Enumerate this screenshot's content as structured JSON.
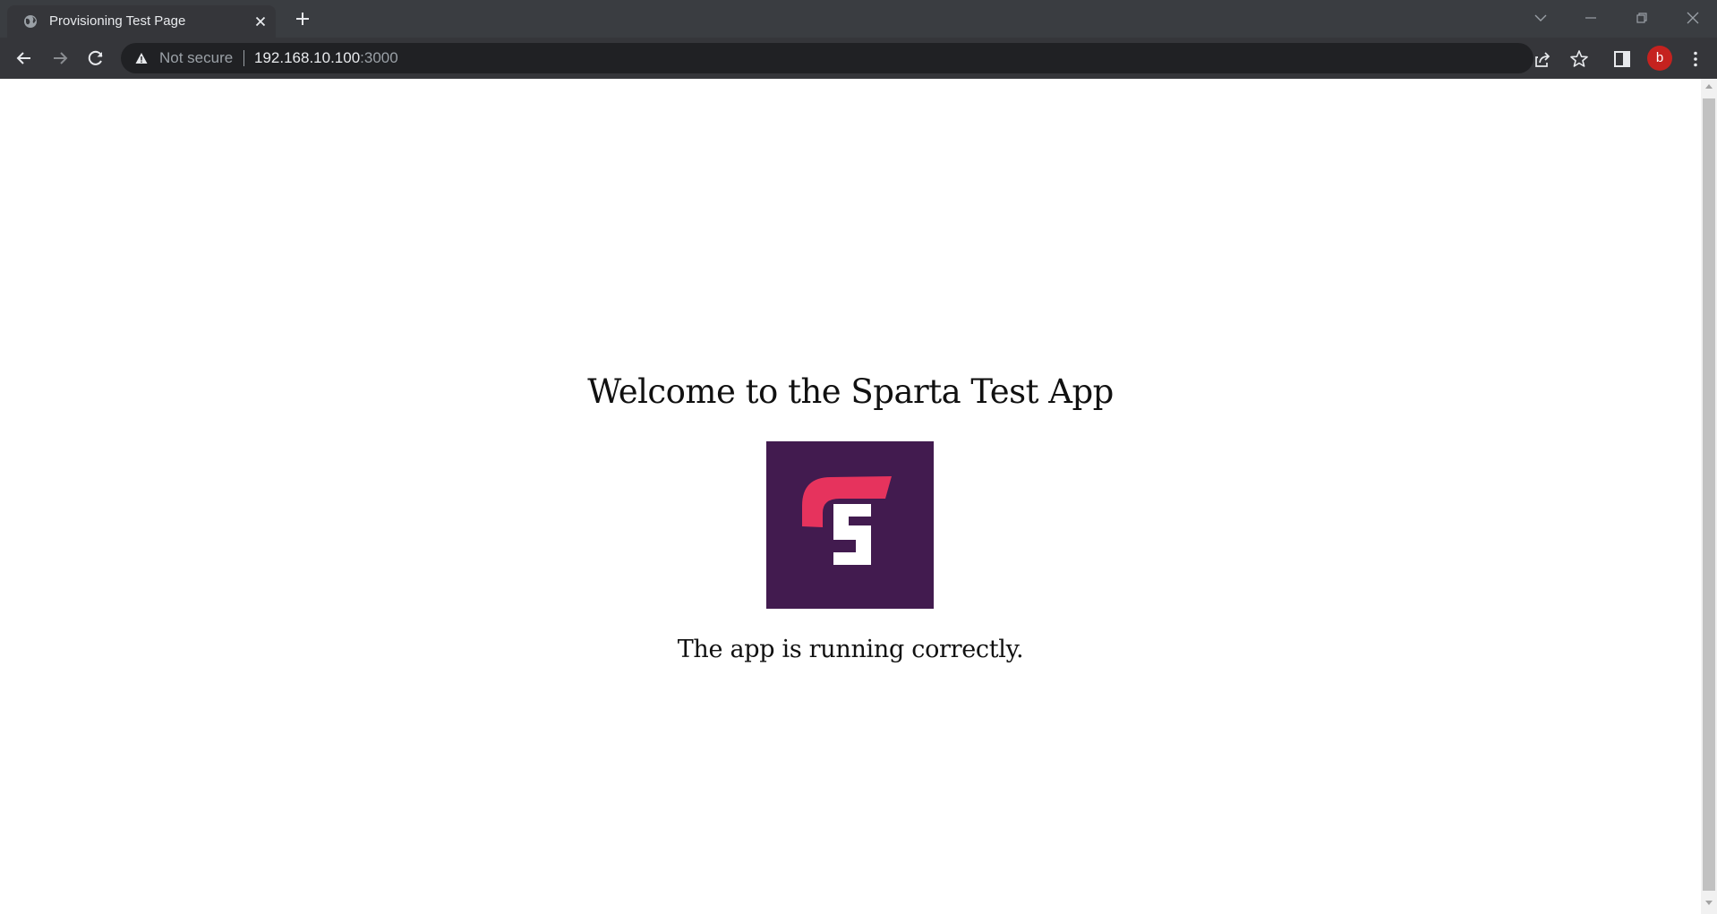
{
  "tab": {
    "title": "Provisioning Test Page",
    "favicon": "globe-icon",
    "close_icon": "close-icon"
  },
  "window_controls": [
    "tab-search-icon",
    "minimize-icon",
    "restore-icon",
    "close-window-icon"
  ],
  "toolbar": {
    "back_icon": "back-arrow-icon",
    "forward_icon": "forward-arrow-icon",
    "reload_icon": "reload-icon",
    "security_label": "Not secure",
    "url_host": "192.168.10.100",
    "url_port": ":3000",
    "share_icon": "share-icon",
    "bookmark_icon": "star-icon",
    "side_panel_icon": "side-panel-icon",
    "profile_initial": "b",
    "menu_icon": "kebab-menu-icon"
  },
  "page": {
    "heading": "Welcome to the Sparta Test App",
    "logo": "sparta-logo",
    "status_text": "The app is running correctly."
  },
  "colors": {
    "tabstrip_bg": "#3a3d41",
    "toolbar_bg": "#35363a",
    "omnibox_bg": "#202124",
    "logo_bg": "#421b4f",
    "logo_accent": "#e6335d",
    "avatar_bg": "#c5221f"
  }
}
